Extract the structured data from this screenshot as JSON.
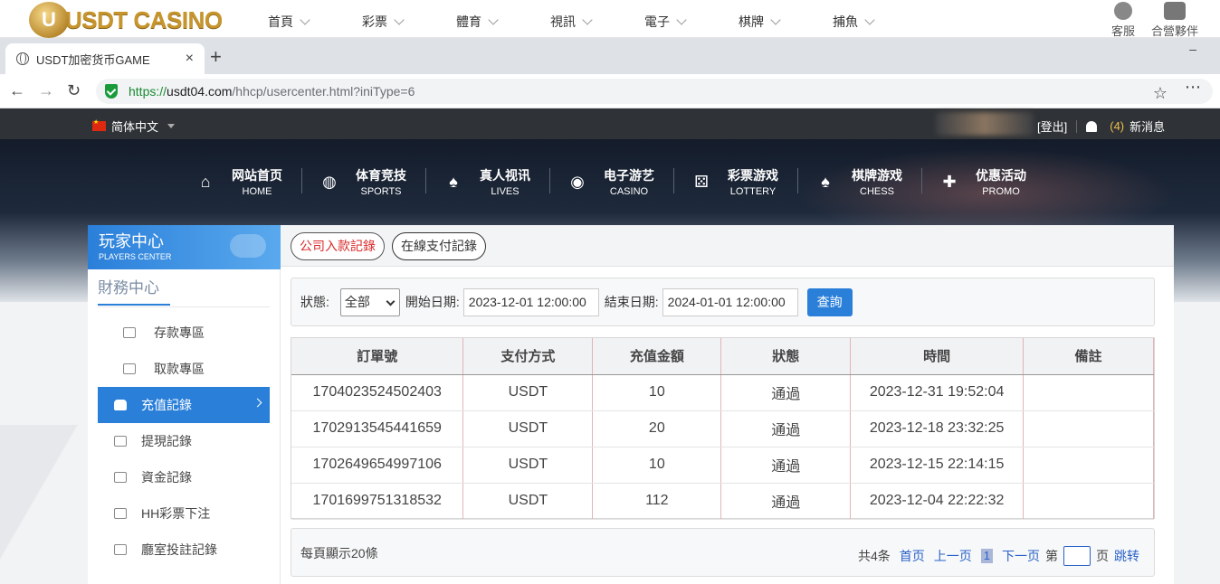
{
  "site_header": {
    "logo_letter": "U",
    "logo_text": "USDT CASINO",
    "nav": [
      "首頁",
      "彩票",
      "體育",
      "視訊",
      "電子",
      "棋牌",
      "捕魚"
    ],
    "right": [
      {
        "label": "客服",
        "icon": "chat-icon"
      },
      {
        "label": "合營夥伴",
        "icon": "partners-icon"
      }
    ]
  },
  "browser": {
    "tab_title": "USDT加密货币GAME",
    "tab_close": "×",
    "new_tab": "+",
    "minimize": "–",
    "url_https": "https://",
    "url_host": "usdt04.com",
    "url_path": "/hhcp/usercenter.html?iniType=6",
    "back": "←",
    "forward": "→",
    "reload": "↻",
    "star": "☆",
    "more": "⋯"
  },
  "topbar": {
    "language": "简体中文",
    "logout": "[登出]",
    "msg_count": "(4)",
    "msg_label": "新消息"
  },
  "main_nav": [
    {
      "cn": "网站首页",
      "en": "HOME",
      "icon": "home-icon",
      "glyph": "⌂"
    },
    {
      "cn": "体育竞技",
      "en": "SPORTS",
      "icon": "ball-icon",
      "glyph": "◍"
    },
    {
      "cn": "真人视讯",
      "en": "LIVES",
      "icon": "cards-icon",
      "glyph": "♠"
    },
    {
      "cn": "电子游艺",
      "en": "CASINO",
      "icon": "slot-icon",
      "glyph": "◉"
    },
    {
      "cn": "彩票游戏",
      "en": "LOTTERY",
      "icon": "dice-icon",
      "glyph": "⚄"
    },
    {
      "cn": "棋牌游戏",
      "en": "CHESS",
      "icon": "spade-icon",
      "glyph": "♠"
    },
    {
      "cn": "优惠活动",
      "en": "PROMO",
      "icon": "gift-icon",
      "glyph": "✚"
    }
  ],
  "sidebar": {
    "title_cn": "玩家中心",
    "title_en": "PLAYERS CENTER",
    "section": "財務中心",
    "items": [
      {
        "label": "存款專區",
        "icon": "deposit-icon"
      },
      {
        "label": "取款專區",
        "icon": "withdraw-icon"
      },
      {
        "label": "充值記錄",
        "icon": "recharge-record-icon",
        "active": true
      },
      {
        "label": "提現記錄",
        "icon": "withdraw-record-icon"
      },
      {
        "label": "資金記錄",
        "icon": "funds-record-icon"
      },
      {
        "label": "HH彩票下注",
        "icon": "lottery-bet-icon"
      },
      {
        "label": "廳室投註記錄",
        "icon": "hall-bet-icon"
      }
    ]
  },
  "tabs": [
    {
      "label": "公司入款記錄",
      "active": true
    },
    {
      "label": "在線支付記錄",
      "active": false
    }
  ],
  "filter": {
    "status_label": "狀態:",
    "status_value": "全部",
    "start_label": "開始日期:",
    "start_value": "2023-12-01 12:00:00",
    "end_label": "結束日期:",
    "end_value": "2024-01-01 12:00:00",
    "query_label": "查詢"
  },
  "table": {
    "columns": [
      "訂單號",
      "支付方式",
      "充值金額",
      "狀態",
      "時間",
      "備註"
    ],
    "rows": [
      [
        "1704023524502403",
        "USDT",
        "10",
        "通過",
        "2023-12-31 19:52:04",
        ""
      ],
      [
        "1702913545441659",
        "USDT",
        "20",
        "通過",
        "2023-12-18 23:32:25",
        ""
      ],
      [
        "1702649654997106",
        "USDT",
        "10",
        "通過",
        "2023-12-15 22:14:15",
        ""
      ],
      [
        "1701699751318532",
        "USDT",
        "112",
        "通過",
        "2023-12-04 22:22:32",
        ""
      ]
    ]
  },
  "pager": {
    "per_page": "每頁顯示20條",
    "total": "共4条",
    "first": "首页",
    "prev": "上一页",
    "current": "1",
    "next": "下一页",
    "page_prefix": "第",
    "page_suffix": "页",
    "jump": "跳转"
  }
}
